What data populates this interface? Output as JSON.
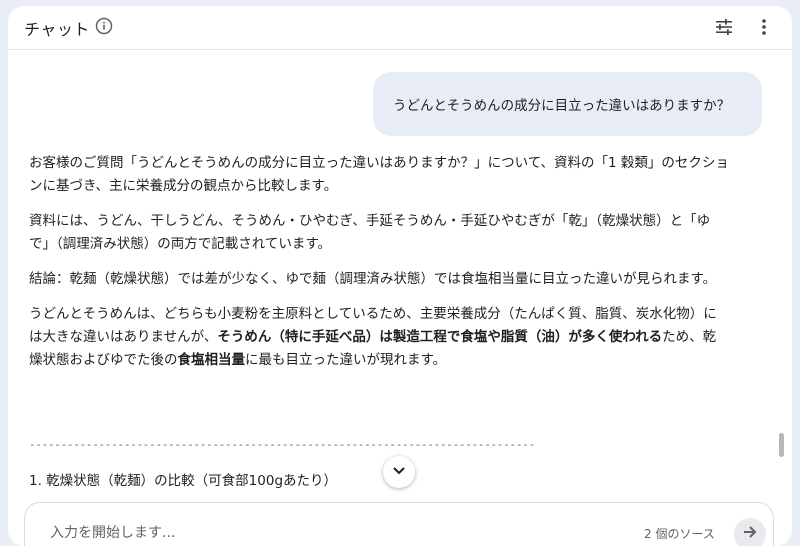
{
  "header": {
    "title": "チャット"
  },
  "user_message": "うどんとそうめんの成分に目立った違いはありますか？",
  "answer": {
    "p1": "お客様のご質問「うどんとそうめんの成分に目立った違いはありますか？」について、資料の「1 穀類」のセクションに基づき、主に栄養成分の観点から比較します。",
    "p2": "資料には、うどん、干しうどん、そうめん・ひやむぎ、手延そうめん・手延ひやむぎが「乾」（乾燥状態）と「ゆで」（調理済み状態）の両方で記載されています。",
    "p3": "結論：乾麺（乾燥状態）では差が少なく、ゆで麺（調理済み状態）では食塩相当量に目立った違いが見られます。",
    "p4_a": "うどんとそうめんは、どちらも小麦粉を主原料としているため、主要栄養成分（たんぱく質、脂質、炭水化物）には大きな違いはありませんが、",
    "p4_b": "そうめん（特に手延べ品）は製造工程で食塩や脂質（油）が多く使われる",
    "p4_c": "ため、乾燥状態およびゆでた後の",
    "p4_d": "食塩相当量",
    "p4_e": "に最も目立った違いが現れます。",
    "divider": "--------------------------------------------------------------------------------",
    "section1": "1. 乾燥状態（乾麺）の比較（可食部100gあたり）"
  },
  "input": {
    "placeholder": "入力を開始します...",
    "source_count": "2 個のソース"
  },
  "icons": {
    "info": "info-icon",
    "tune": "tune-icon",
    "more": "more-vert-icon",
    "scroll_down": "chevron-down-icon",
    "send": "arrow-right-icon"
  }
}
